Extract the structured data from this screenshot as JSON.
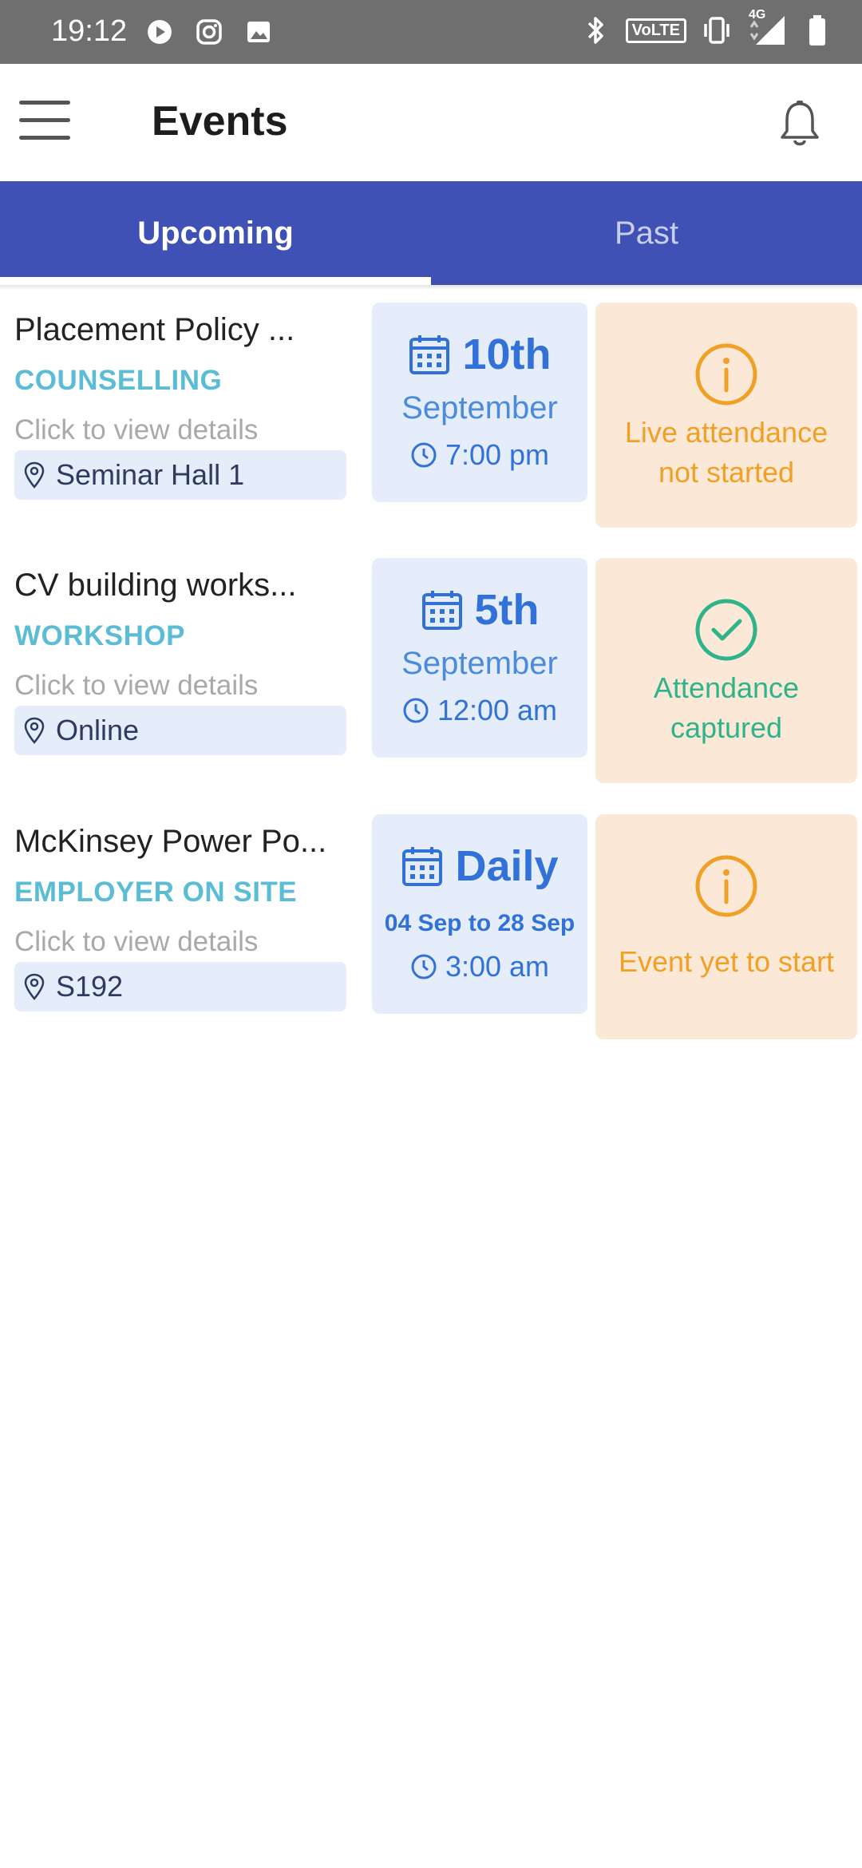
{
  "status_bar": {
    "time": "19:12",
    "left_icons": [
      "play-icon",
      "instagram-icon",
      "image-icon"
    ],
    "volte_label": "VoLTE",
    "network_label": "4G",
    "right_icons": [
      "bluetooth-icon",
      "volte-icon",
      "vibrate-icon",
      "signal-icon",
      "battery-icon"
    ]
  },
  "header": {
    "title": "Events",
    "menu_icon": "hamburger-menu-icon",
    "bell_icon": "bell-icon"
  },
  "tabs": [
    {
      "label": "Upcoming",
      "active": true
    },
    {
      "label": "Past",
      "active": false
    }
  ],
  "colors": {
    "primary": "#3f51b5",
    "category": "#5bbcd6",
    "date_blue": "#3272d8",
    "status_bg": "#fbe8d7",
    "warning": "#f0a025",
    "success": "#2fb38a"
  },
  "events": [
    {
      "title": "Placement Policy ...",
      "category": "COUNSELLING",
      "hint": "Click to view details",
      "location": "Seminar Hall 1",
      "date_main": "10th",
      "date_sub": "September",
      "time": "7:00 pm",
      "status": "Live attendance not started",
      "status_type": "info"
    },
    {
      "title": "CV building works...",
      "category": "WORKSHOP",
      "hint": "Click to view details",
      "location": "Online",
      "date_main": "5th",
      "date_sub": "September",
      "time": "12:00 am",
      "status": "Attendance captured",
      "status_type": "success"
    },
    {
      "title": "McKinsey Power Po...",
      "category": "EMPLOYER ON SITE",
      "hint": "Click to view details",
      "location": "S192",
      "date_main": "Daily",
      "date_sub": "04 Sep to 28 Sep",
      "time": "3:00 am",
      "status": "Event yet to start",
      "status_type": "info"
    }
  ]
}
